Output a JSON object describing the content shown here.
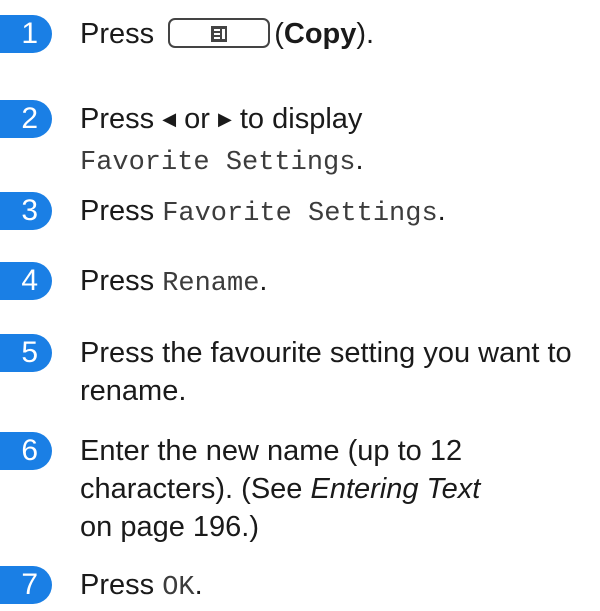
{
  "steps": [
    {
      "number": "1",
      "press": "Press",
      "copy_label": "Copy",
      "paren_open": "(",
      "paren_close": ")."
    },
    {
      "number": "2",
      "text_a": "Press",
      "text_b": "or",
      "text_c": "to display",
      "setting": "Favorite Settings",
      "dot": "."
    },
    {
      "number": "3",
      "press": "Press",
      "button": "Favorite Settings",
      "dot": "."
    },
    {
      "number": "4",
      "press": "Press",
      "button": "Rename",
      "dot": "."
    },
    {
      "number": "5",
      "line1": "Press the favourite setting you want to",
      "line2": "rename."
    },
    {
      "number": "6",
      "line1": "Enter the new name (up to 12",
      "line2_a": "characters). (See",
      "link": "Entering Text",
      "line3": "on page 196.)"
    },
    {
      "number": "7",
      "press": "Press",
      "button": "OK",
      "dot": "."
    }
  ],
  "colors": {
    "badge": "#1a7fe5"
  },
  "icons": {
    "copy_key": "copy-document-icon",
    "left_arrow": "left-arrow-icon",
    "right_arrow": "right-arrow-icon"
  }
}
